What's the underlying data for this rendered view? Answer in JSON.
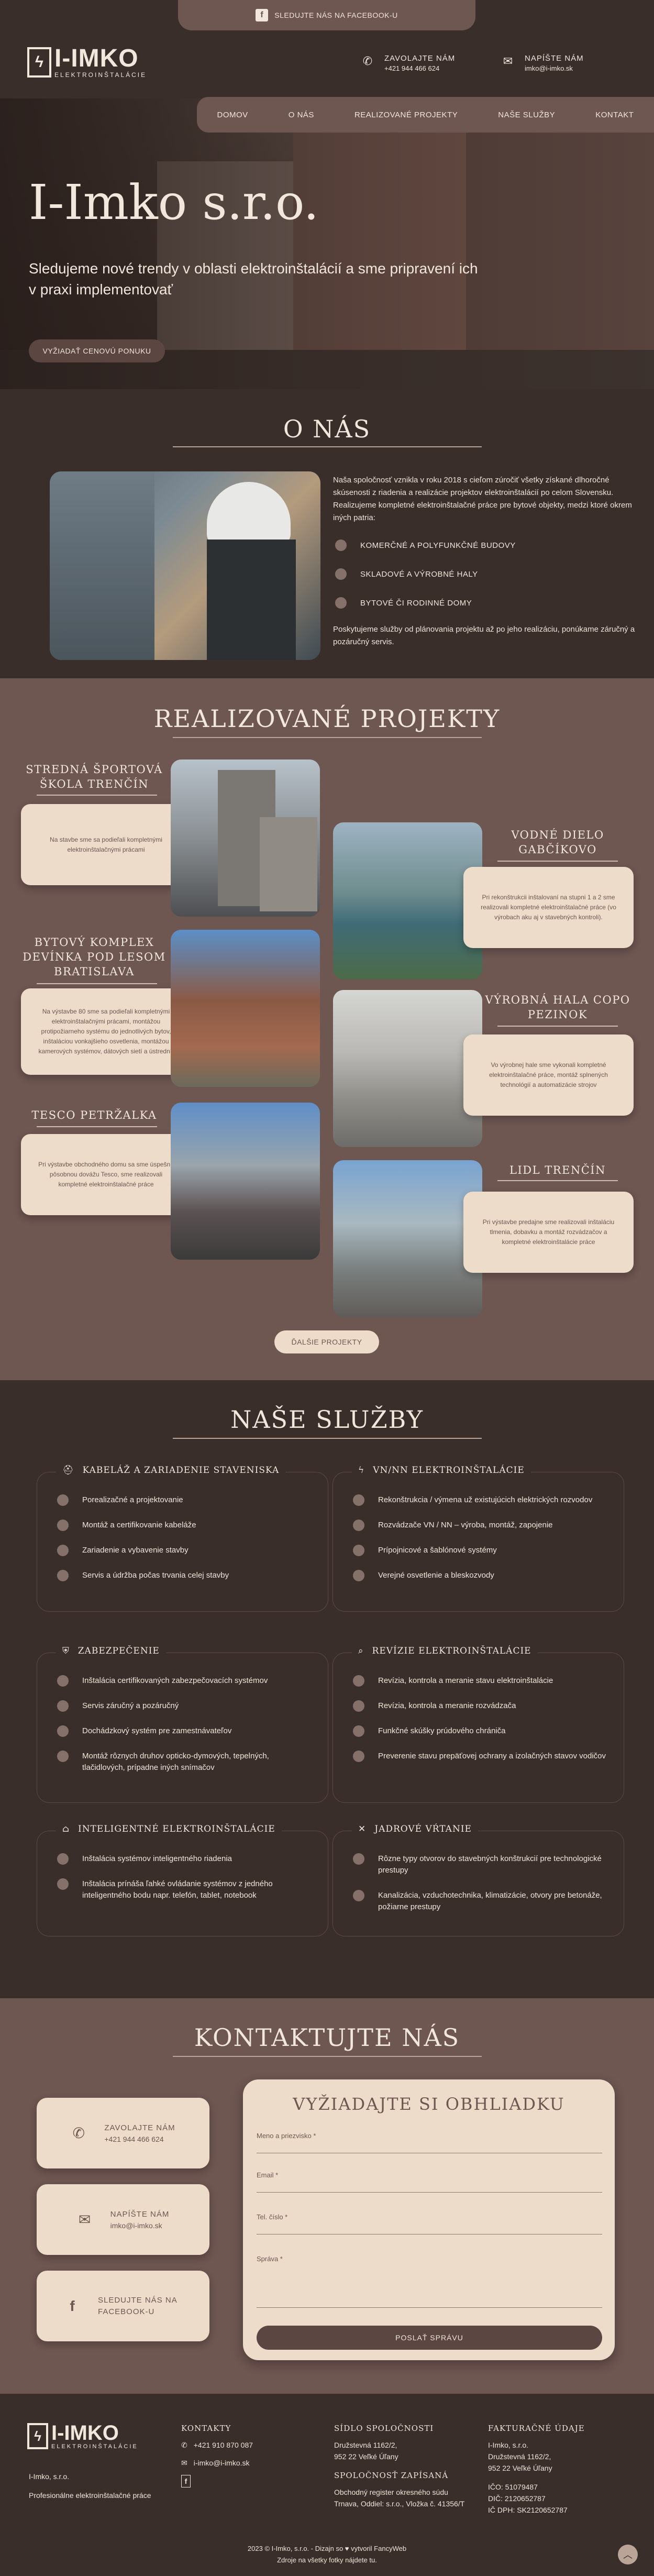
{
  "topbar": {
    "facebook_label": "SLEDUJTE NÁS NA FACEBOOK-U"
  },
  "header": {
    "logo_text": "I-IMKO",
    "logo_sub": "ELEKTROINŠTALÁCIE",
    "call_label": "ZAVOLAJTE NÁM",
    "call_value": "+421 944 466 624",
    "mail_label": "NAPÍŠTE NÁM",
    "mail_value": "imko@i-imko.sk"
  },
  "nav": {
    "items": [
      "DOMOV",
      "O NÁS",
      "REALIZOVANÉ PROJEKTY",
      "NAŠE SLUŽBY",
      "KONTAKT"
    ]
  },
  "hero": {
    "title": "I-Imko s.r.o.",
    "subtitle": "Sledujeme nové trendy v oblasti elektroinštalácií a sme pripravení ich v praxi implementovať",
    "cta": "VYŽIADAŤ CENOVÚ PONUKU"
  },
  "about": {
    "title": "O NÁS",
    "text": "Naša spoločnosť vznikla v roku 2018 s cieľom zúročiť všetky získané dlhoročné skúsenosti z riadenia a realizácie projektov elektroinštalácií po celom Slovensku. Realizujeme kompletné elektroinštalačné práce pre bytové objekty, medzi ktoré okrem iných patria:",
    "items": [
      "KOMERČNÉ A POLYFUNKČNÉ BUDOVY",
      "SKLADOVÉ A VÝROBNÉ HALY",
      "BYTOVÉ ČI RODINNÉ DOMY"
    ],
    "footer_text": "Poskytujeme služby od plánovania projektu až po jeho realizáciu, ponúkame záručný a pozáručný servis."
  },
  "projects": {
    "title": "REALIZOVANÉ PROJEKTY",
    "items": [
      {
        "name": "STREDNÁ ŠPORTOVÁ ŠKOLA TRENČÍN",
        "text": "Na stavbe sme sa podieľali kompletnými elektroinštalačnými prácami"
      },
      {
        "name": "VODNÉ DIELO GABČÍKOVO",
        "text": "Pri rekonštrukcii inštalovaní na stupni 1 a 2 sme realizovali kompletné elektroinštalačné práce (vo výrobach aku aj v stavebných kontroli)."
      },
      {
        "name": "BYTOVÝ KOMPLEX DEVÍNKA POD LESOM BRATISLAVA",
        "text": "Na výstavbe 80 sme sa podieľali kompletnými elektroinštalačnými prácami, montážou protipožiarneho systému do jednotlivých bytov, inštaláciou vonkajšieho osvetlenia, montážou kamerových systémov, dátových sietí a ústrední."
      },
      {
        "name": "VÝROBNÁ HALA COPO PEZINOK",
        "text": "Vo výrobnej hale sme vykonali kompletné elektroinštalačné práce, montáž splnených technológií a automatizácie strojov"
      },
      {
        "name": "TESCO PETRŽALKA",
        "text": "Pri výstavbe obchodného domu sa sme úspešnu pôsobnou dovážu Tesco, sme realizovali kompletné elektroinštalačné práce"
      },
      {
        "name": "LIDL TRENČÍN",
        "text": "Pri výstavbe predajne sme realizovali inštaláciu tlmenia, dobavku a montáž rozvádzačov a kompletné elektroinštalácie práce"
      }
    ],
    "more": "ĎALŠIE PROJEKTY"
  },
  "services": {
    "title": "NAŠE SLUŽBY",
    "blocks": [
      {
        "icon": "worker-icon",
        "title": "KABELÁŽ A ZARIADENIE STAVENISKA",
        "items": [
          "Porealizačné a projektovanie",
          "Montáž a certifikovanie kabeláže",
          "Zariadenie a vybavenie stavby",
          "Servis a údržba počas trvania celej stavby"
        ]
      },
      {
        "icon": "lightning-icon",
        "title": "VN/NN ELEKTROINŠTALÁCIE",
        "items": [
          "Rekonštrukcia / výmena už existujúcich elektrických rozvodov",
          "Rozvádzače VN / NN – výroba, montáž, zapojenie",
          "Prípojnicové a šablónové systémy",
          "Verejné osvetlenie a bleskozvody"
        ]
      },
      {
        "icon": "shield-icon",
        "title": "ZABEZPEČENIE",
        "items": [
          "Inštalácia certifikovaných zabezpečovacích systémov",
          "Servis záručný a pozáručný",
          "Dochádzkový systém pre zamestnávateľov",
          "Montáž rôznych druhov opticko-dymových, tepelných, tlačidlových, prípadne iných snímačov"
        ]
      },
      {
        "icon": "search-icon",
        "title": "REVÍZIE ELEKTROINŠTALÁCIE",
        "items": [
          "Revízia, kontrola a meranie stavu elektroinštalácie",
          "Revízia, kontrola a meranie rozvádzača",
          "Funkčné skúšky prúdového chrániča",
          "Preverenie stavu prepäťovej ochrany a izolačných stavov vodičov"
        ]
      },
      {
        "icon": "smart-home-icon",
        "title": "INTELIGENTNÉ ELEKTROINŠTALÁCIE",
        "items": [
          "Inštalácia systémov inteligentného riadenia",
          "Inštalácia prínáša ľahké ovládanie systémov z jedného inteligentného bodu napr. telefón, tablet, notebook"
        ]
      },
      {
        "icon": "tools-icon",
        "title": "JADROVÉ VŔTANIE",
        "items": [
          "Rôzne typy otvorov do stavebných konštrukcií pre technologické prestupy",
          "Kanalizácia, vzduchotechnika, klimatizácie, otvory pre betonáže, požiarne prestupy"
        ]
      }
    ]
  },
  "contact": {
    "title": "KONTAKTUJTE NÁS",
    "boxes": [
      {
        "icon": "phone-icon",
        "label": "ZAVOLAJTE NÁM",
        "value": "+421 944 466 624"
      },
      {
        "icon": "mail-icon",
        "label": "NAPÍŠTE NÁM",
        "value": "imko@i-imko.sk"
      },
      {
        "icon": "facebook-icon",
        "label": "SLEDUJTE NÁS NA FACEBOOK-U",
        "value": ""
      }
    ],
    "form": {
      "title": "VYŽIADAJTE SI OBHLIADKU",
      "name_label": "Meno a priezvisko *",
      "email_label": "Email *",
      "phone_label": "Tel. číslo *",
      "message_label": "Správa *",
      "submit": "POSLAŤ SPRÁVU"
    }
  },
  "footer": {
    "logo_text": "I-IMKO",
    "logo_sub": "ELEKTROINŠTALÁCIE",
    "company": "I-Imko, s.r.o.",
    "tagline": "Profesionálne elektroinštalačné práce",
    "contacts_title": "KONTAKTY",
    "phone": "+421 910 870 087",
    "email": "i-imko@i-imko.sk",
    "seat_title": "SÍDLO SPOLOČNOSTI",
    "seat_lines": [
      "Družstevná 1162/2,",
      "952 22 Veľké Úľany"
    ],
    "reg_title": "SPOLOČNOSŤ ZAPÍSANÁ",
    "reg_lines": [
      "Obchodný register okresného súdu",
      "Trnava, Oddiel: s.r.o., Vložka č. 41356/T"
    ],
    "bill_title": "FAKTURAČNÉ ÚDAJE",
    "bill_lines": [
      "I-Imko, s.r.o.",
      "Družstevná 1162/2,",
      "952 22 Veľké Úľany"
    ],
    "ids": [
      "IČO: 51079487",
      "DIČ: 2120652787",
      "IČ DPH: SK2120652787"
    ],
    "copyright": "2023 © I-Imko, s.r.o. - Dizajn so ♥ vytvoril FancyWeb",
    "source": "Zdroje na všetky fotky nájdete tu."
  }
}
